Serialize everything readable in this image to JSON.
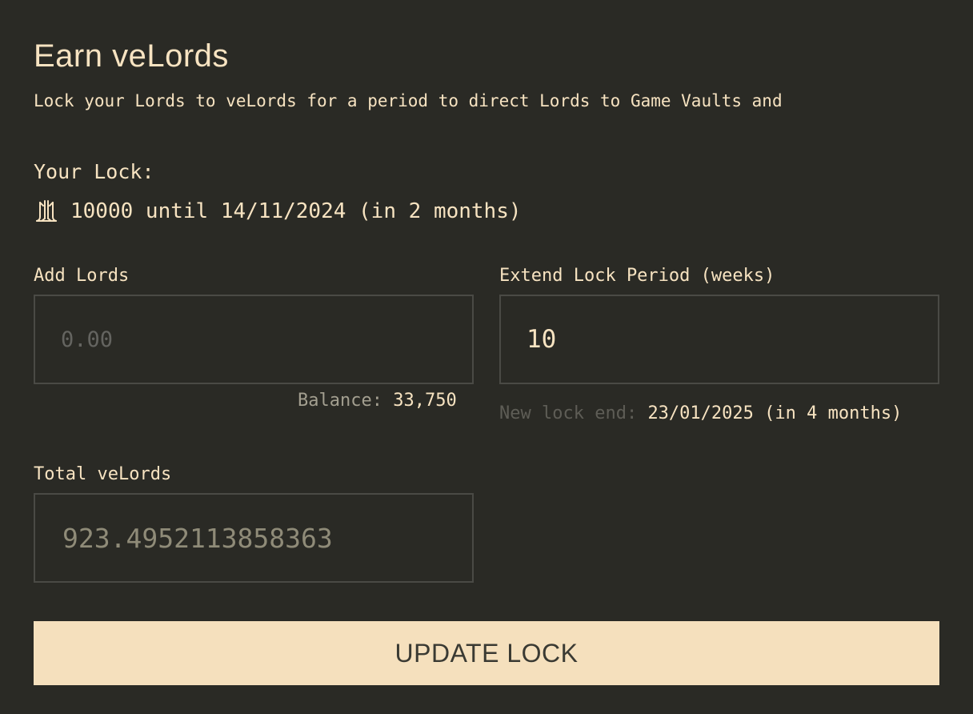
{
  "header": {
    "title": "Earn veLords",
    "subtitle": "Lock your Lords to veLords for a period to direct Lords to Game Vaults and"
  },
  "current_lock": {
    "label": "Your Lock:",
    "icon": "lords-token-icon",
    "summary": "10000 until 14/11/2024 (in 2 months)"
  },
  "add_lords": {
    "label": "Add Lords",
    "value": "",
    "placeholder": "0.00",
    "balance_label": "Balance:",
    "balance_value": "33,750"
  },
  "extend_lock": {
    "label": "Extend Lock Period (weeks)",
    "value": "10",
    "new_end_label": "New lock end:",
    "new_end_value": "23/01/2025 (in 4 months)"
  },
  "total_velords": {
    "label": "Total veLords",
    "value": "923.4952113858363"
  },
  "actions": {
    "update_label": "UPDATE LOCK"
  },
  "colors": {
    "background": "#2a2a25",
    "text": "#f7e3c1",
    "field_border": "#4a4a45",
    "button_bg": "#f5e0bd",
    "button_text": "#3a3a33"
  }
}
